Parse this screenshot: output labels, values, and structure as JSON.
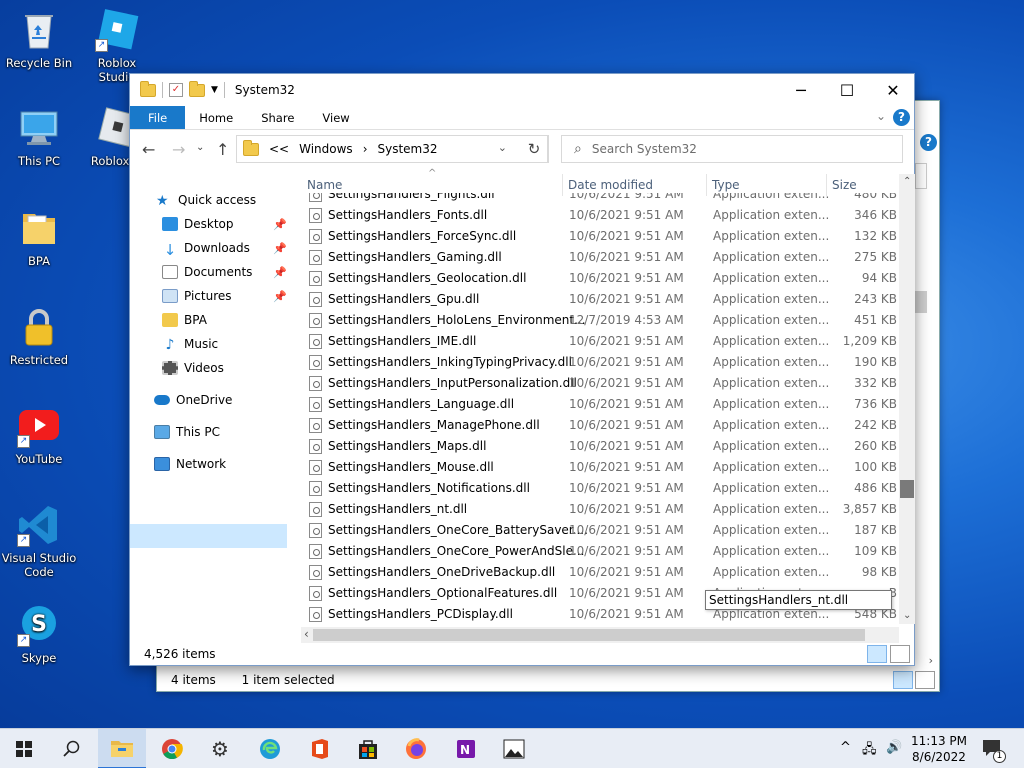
{
  "desktop": {
    "icons": [
      {
        "label": "Recycle Bin",
        "shortcut": false
      },
      {
        "label": "Roblox Studio",
        "shortcut": true
      },
      {
        "label": "This PC",
        "shortcut": false
      },
      {
        "label": "Roblox Pl",
        "shortcut": true
      },
      {
        "label": "BPA",
        "shortcut": false
      },
      {
        "label": "Restricted",
        "shortcut": false
      },
      {
        "label": "YouTube",
        "shortcut": true
      },
      {
        "label": "Visual Studio Code",
        "shortcut": true
      },
      {
        "label": "Skype",
        "shortcut": true
      }
    ]
  },
  "back_window": {
    "item_count": "4 items",
    "selection": "1 item selected"
  },
  "window": {
    "title": "System32",
    "ribbon_tabs": [
      "File",
      "Home",
      "Share",
      "View"
    ],
    "help_label": "?",
    "address": {
      "overflow": "<<",
      "crumbs": [
        "Windows",
        "System32"
      ]
    },
    "search_placeholder": "Search System32",
    "nav": {
      "quick_access": "Quick access",
      "quick_items": [
        "Desktop",
        "Downloads",
        "Documents",
        "Pictures",
        "BPA",
        "Music",
        "Videos"
      ],
      "onedrive": "OneDrive",
      "this_pc": "This PC",
      "network": "Network"
    },
    "columns": {
      "name": "Name",
      "date": "Date modified",
      "type": "Type",
      "size": "Size"
    },
    "files": [
      {
        "name": "SettingsHandlers_Flights.dll",
        "date": "10/6/2021 9:51 AM",
        "type": "Application exten...",
        "size": "480 KB"
      },
      {
        "name": "SettingsHandlers_Fonts.dll",
        "date": "10/6/2021 9:51 AM",
        "type": "Application exten...",
        "size": "346 KB"
      },
      {
        "name": "SettingsHandlers_ForceSync.dll",
        "date": "10/6/2021 9:51 AM",
        "type": "Application exten...",
        "size": "132 KB"
      },
      {
        "name": "SettingsHandlers_Gaming.dll",
        "date": "10/6/2021 9:51 AM",
        "type": "Application exten...",
        "size": "275 KB"
      },
      {
        "name": "SettingsHandlers_Geolocation.dll",
        "date": "10/6/2021 9:51 AM",
        "type": "Application exten...",
        "size": "94 KB"
      },
      {
        "name": "SettingsHandlers_Gpu.dll",
        "date": "10/6/2021 9:51 AM",
        "type": "Application exten...",
        "size": "243 KB"
      },
      {
        "name": "SettingsHandlers_HoloLens_Environment...",
        "date": "12/7/2019 4:53 AM",
        "type": "Application exten...",
        "size": "451 KB"
      },
      {
        "name": "SettingsHandlers_IME.dll",
        "date": "10/6/2021 9:51 AM",
        "type": "Application exten...",
        "size": "1,209 KB"
      },
      {
        "name": "SettingsHandlers_InkingTypingPrivacy.dll",
        "date": "10/6/2021 9:51 AM",
        "type": "Application exten...",
        "size": "190 KB"
      },
      {
        "name": "SettingsHandlers_InputPersonalization.dll",
        "date": "10/6/2021 9:51 AM",
        "type": "Application exten...",
        "size": "332 KB"
      },
      {
        "name": "SettingsHandlers_Language.dll",
        "date": "10/6/2021 9:51 AM",
        "type": "Application exten...",
        "size": "736 KB"
      },
      {
        "name": "SettingsHandlers_ManagePhone.dll",
        "date": "10/6/2021 9:51 AM",
        "type": "Application exten...",
        "size": "242 KB"
      },
      {
        "name": "SettingsHandlers_Maps.dll",
        "date": "10/6/2021 9:51 AM",
        "type": "Application exten...",
        "size": "260 KB"
      },
      {
        "name": "SettingsHandlers_Mouse.dll",
        "date": "10/6/2021 9:51 AM",
        "type": "Application exten...",
        "size": "100 KB"
      },
      {
        "name": "SettingsHandlers_Notifications.dll",
        "date": "10/6/2021 9:51 AM",
        "type": "Application exten...",
        "size": "486 KB"
      },
      {
        "name": "SettingsHandlers_nt.dll",
        "date": "10/6/2021 9:51 AM",
        "type": "Application exten...",
        "size": "3,857 KB"
      },
      {
        "name": "SettingsHandlers_OneCore_BatterySaver....",
        "date": "10/6/2021 9:51 AM",
        "type": "Application exten...",
        "size": "187 KB"
      },
      {
        "name": "SettingsHandlers_OneCore_PowerAndSle...",
        "date": "10/6/2021 9:51 AM",
        "type": "Application exten...",
        "size": "109 KB"
      },
      {
        "name": "SettingsHandlers_OneDriveBackup.dll",
        "date": "10/6/2021 9:51 AM",
        "type": "Application exten...",
        "size": "98 KB"
      },
      {
        "name": "SettingsHandlers_OptionalFeatures.dll",
        "date": "10/6/2021 9:51 AM",
        "type": "Application exten...",
        "size": "B"
      },
      {
        "name": "SettingsHandlers_PCDisplay.dll",
        "date": "10/6/2021 9:51 AM",
        "type": "Application exten...",
        "size": "548 KB"
      }
    ],
    "tooltip": "SettingsHandlers_nt.dll",
    "status_count": "4,526 items"
  },
  "taskbar": {
    "time": "11:13 PM",
    "date": "8/6/2022",
    "notification_count": "1"
  },
  "colors": {
    "accent": "#1979ca",
    "selection": "#cce8ff"
  }
}
